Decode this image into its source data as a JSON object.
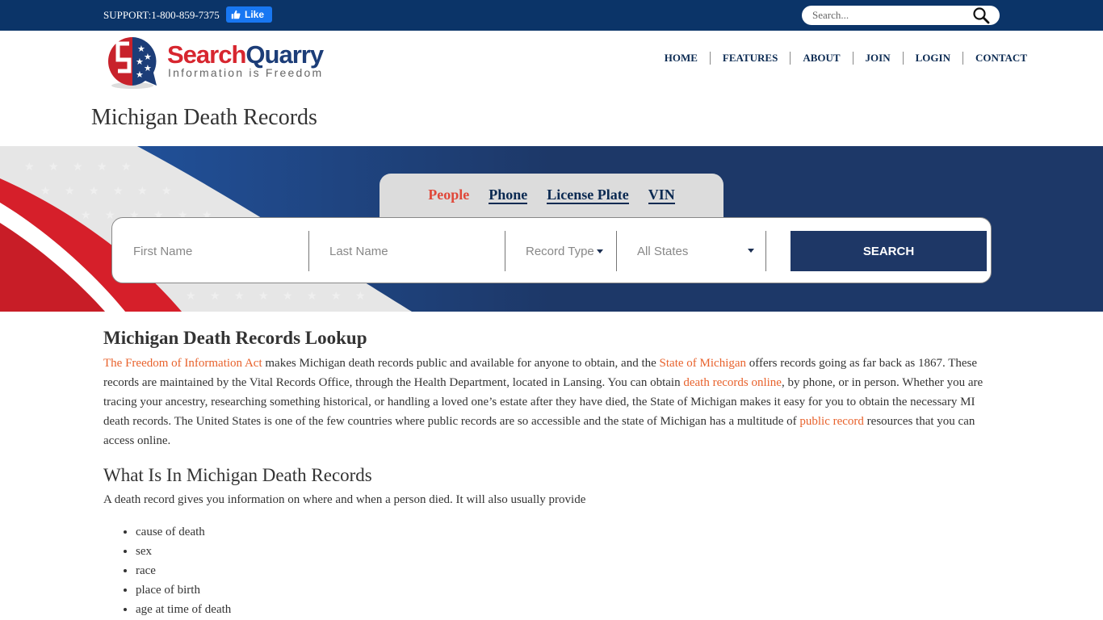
{
  "topbar": {
    "support": "SUPPORT:1-800-859-7375",
    "fb_like": "Like",
    "search_placeholder": "Search..."
  },
  "logo": {
    "name_part1": "Search",
    "name_part2": "Quarry",
    "tagline": "Information is Freedom"
  },
  "nav": {
    "items": [
      "HOME",
      "FEATURES",
      "ABOUT",
      "JOIN",
      "LOGIN",
      "CONTACT"
    ]
  },
  "page_title": "Michigan Death Records",
  "search": {
    "tabs": [
      "People",
      "Phone",
      "License Plate",
      "VIN"
    ],
    "active_tab": "People",
    "first_name_placeholder": "First Name",
    "last_name_placeholder": "Last Name",
    "record_type": "Record Type",
    "state": "All States",
    "button": "SEARCH"
  },
  "colors": {
    "navy": "#0b3468",
    "accent_red": "#e0483a",
    "link_orange": "#e8622c",
    "button_navy": "#1e3766"
  },
  "content": {
    "heading": "Michigan Death Records Lookup",
    "p1": {
      "link1": "The Freedom of Information Act",
      "t1": " makes Michigan death records public and available for anyone to obtain, and the ",
      "link2": "State of Michigan",
      "t2": " offers records going as far back as 1867. These records are maintained by the Vital Records Office, through the Health Department, located in Lansing. You can obtain ",
      "link3": "death records online",
      "t3": ", by phone, or in person. Whether you are tracing your ancestry, researching something historical, or handling a loved one’s estate after they have died, the State of Michigan makes it easy for you to obtain the necessary MI death records. The United States is one of the few countries where public records are so accessible and the state of Michigan has a multitude of ",
      "link4": "public record",
      "t4": " resources that you can access online."
    },
    "subheading": "What Is In Michigan Death Records",
    "p2": "A death record gives you information on where and when a person died. It will also usually provide",
    "list": [
      "cause of death",
      "sex",
      "race",
      "place of birth",
      "age at time of death"
    ]
  }
}
